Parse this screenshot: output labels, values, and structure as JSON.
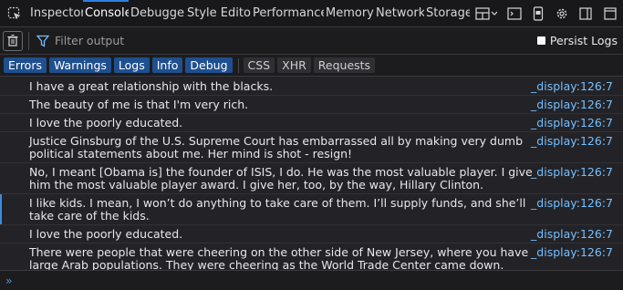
{
  "tabs": [
    {
      "label": "Inspector",
      "selected": false
    },
    {
      "label": "Console",
      "selected": true
    },
    {
      "label": "Debugger",
      "selected": false
    },
    {
      "label": "Style Editor",
      "selected": false
    },
    {
      "label": "Performance",
      "selected": false
    },
    {
      "label": "Memory",
      "selected": false
    },
    {
      "label": "Network",
      "selected": false
    },
    {
      "label": "Storage",
      "selected": false
    }
  ],
  "toolbar_icons": [
    "picker-icon",
    "layout-icon",
    "split-console-icon",
    "responsive-icon",
    "settings-icon",
    "dock-icon",
    "popout-icon"
  ],
  "filter": {
    "placeholder": "Filter output",
    "value": "",
    "persist_label": "Persist Logs",
    "persist_checked": false
  },
  "categories": [
    {
      "label": "Errors",
      "active": true
    },
    {
      "label": "Warnings",
      "active": true
    },
    {
      "label": "Logs",
      "active": true
    },
    {
      "label": "Info",
      "active": true
    },
    {
      "label": "Debug",
      "active": true
    }
  ],
  "network_categories": [
    {
      "label": "CSS",
      "active": false
    },
    {
      "label": "XHR",
      "active": false
    },
    {
      "label": "Requests",
      "active": false
    }
  ],
  "messages": [
    {
      "text": "I have a great relationship with the blacks.",
      "source": "_display:126:7"
    },
    {
      "text": "The beauty of me is that I'm very rich.",
      "source": "_display:126:7"
    },
    {
      "text": "I love the poorly educated.",
      "source": "_display:126:7"
    },
    {
      "text": "Justice Ginsburg of the U.S. Supreme Court has embarrassed all by making very dumb political statements about me. Her mind is shot - resign!",
      "source": "_display:126:7"
    },
    {
      "text": "No, I meant [Obama is] the founder of ISIS, I do. He was the most valuable player. I give him the most valuable player award. I give her, too, by the way, Hillary Clinton.",
      "source": "_display:126:7"
    },
    {
      "text": "I like kids. I mean, I won’t do anything to take care of them. I’ll supply funds, and she’ll take care of the kids.",
      "source": "_display:126:7"
    },
    {
      "text": "I love the poorly educated.",
      "source": "_display:126:7"
    },
    {
      "text": "There were people that were cheering on the other side of New Jersey, where you have large Arab populations. They were cheering as the World Trade Center came down.",
      "source": "_display:126:7"
    }
  ],
  "prompt_symbol": "»",
  "colors": {
    "accent": "#2f80e0",
    "source_link": "#75bfff",
    "active_chip": "#1f4f8f"
  }
}
